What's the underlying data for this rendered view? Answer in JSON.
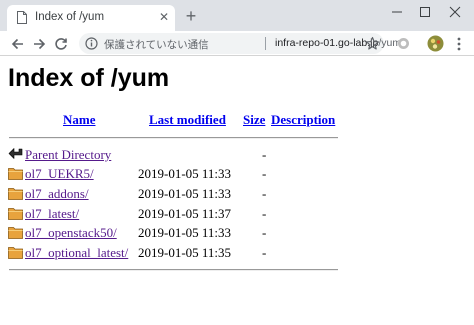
{
  "browser": {
    "tab_title": "Index of /yum",
    "tab_close_icon": "close-icon",
    "new_tab_icon": "plus-icon",
    "window_controls": [
      "minimize-icon",
      "maximize-icon",
      "close-icon"
    ],
    "security_label": "保護されていない通信",
    "url_host": "infra-repo-01.go-lab.jp",
    "url_path": "/yum/",
    "colors": {
      "titlebar": "#dee1e6",
      "omnibox": "#f1f3f4"
    }
  },
  "page": {
    "title": "Index of /yum",
    "columns": {
      "name": "Name",
      "last_modified": "Last modified",
      "size": "Size",
      "description": "Description"
    },
    "rows": [
      {
        "icon": "back-arrow-icon",
        "name": "Parent Directory",
        "date": "",
        "size": "-"
      },
      {
        "icon": "folder-icon",
        "name": "ol7_UEKR5/",
        "date": "2019-01-05 11:33",
        "size": "-"
      },
      {
        "icon": "folder-icon",
        "name": "ol7_addons/",
        "date": "2019-01-05 11:33",
        "size": "-"
      },
      {
        "icon": "folder-icon",
        "name": "ol7_latest/",
        "date": "2019-01-05 11:37",
        "size": "-"
      },
      {
        "icon": "folder-icon",
        "name": "ol7_openstack50/",
        "date": "2019-01-05 11:33",
        "size": "-"
      },
      {
        "icon": "folder-icon",
        "name": "ol7_optional_latest/",
        "date": "2019-01-05 11:35",
        "size": "-"
      }
    ],
    "colors": {
      "link": "#0000ee",
      "visited_link": "#551a8b",
      "folder": "#e8a33d"
    }
  }
}
